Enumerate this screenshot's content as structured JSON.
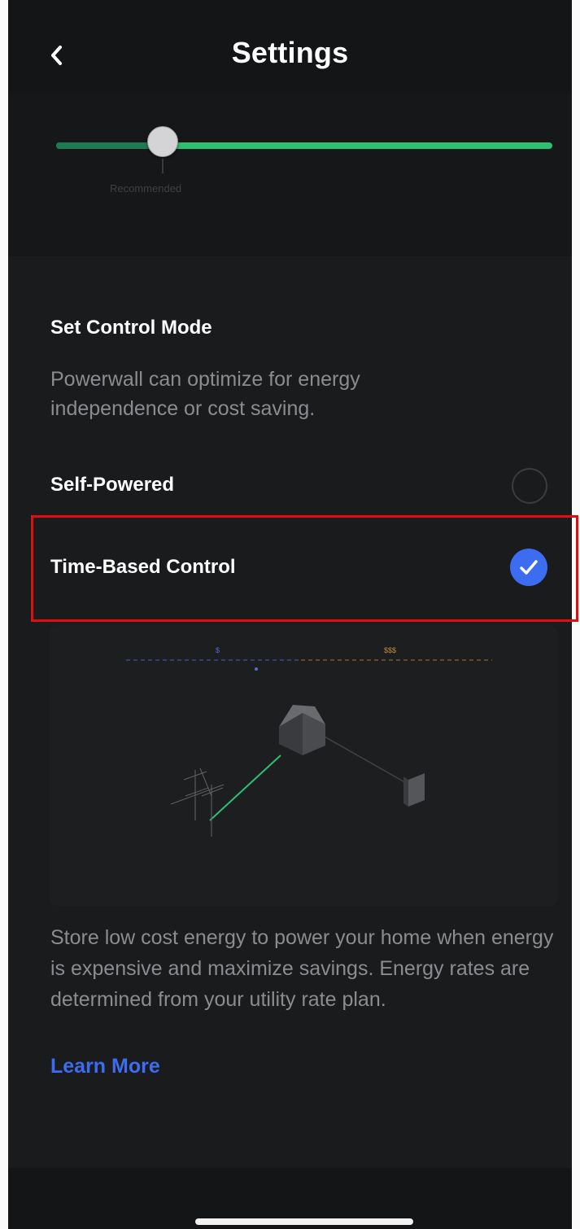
{
  "header": {
    "title": "Settings",
    "back_icon": "chevron-left-icon"
  },
  "reserve_slider": {
    "marker_label": "Recommended",
    "value_fraction": 0.2,
    "accent_color": "#2fbf71"
  },
  "control_mode": {
    "title": "Set Control Mode",
    "description": "Powerwall can optimize for energy independence or cost saving.",
    "options": [
      {
        "label": "Self-Powered",
        "selected": false
      },
      {
        "label": "Time-Based Control",
        "selected": true
      }
    ],
    "selected_color": "#3c6cf0"
  },
  "illustration": {
    "price_markers": [
      "$",
      "$$$"
    ]
  },
  "info": {
    "text": "Store low cost energy to power your home when energy is expensive and maximize savings. Energy rates are determined from your utility rate plan.",
    "learn_more": "Learn More"
  }
}
